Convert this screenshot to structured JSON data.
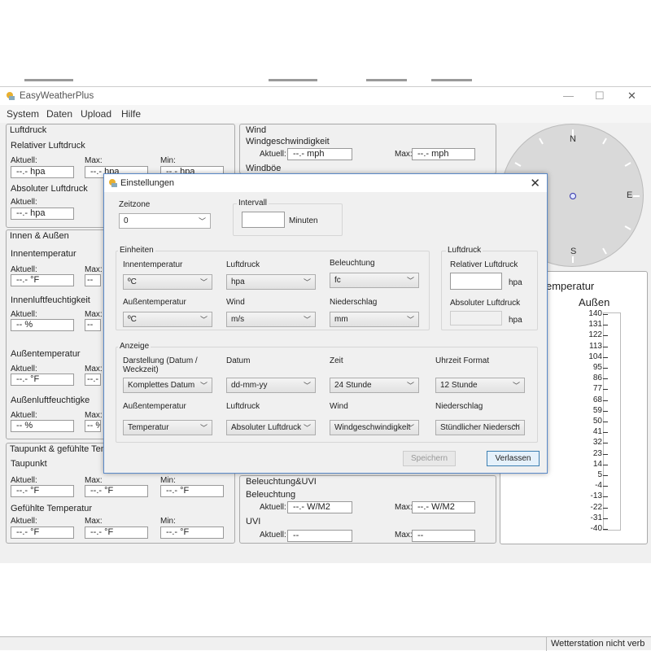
{
  "app": {
    "title": "EasyWeatherPlus",
    "minimize": "—",
    "maximize": "☐",
    "close": "✕"
  },
  "menu": [
    "System",
    "Daten",
    "Upload",
    "Hilfe"
  ],
  "luftdruck": {
    "title": "Luftdruck",
    "relativ": "Relativer Luftdruck",
    "absolut": "Absoluter Luftdruck",
    "aktuell": "Aktuell:",
    "max": "Max:",
    "min": "Min:",
    "rel_akt": "--.- hpa",
    "rel_max": "--.- hpa",
    "rel_min": "--.- hpa",
    "abs_akt": "--.- hpa"
  },
  "wind": {
    "title": "Wind",
    "geschw": "Windgeschwindigkeit",
    "aktuell": "Aktuell:",
    "max": "Max:",
    "akt_val": "--.- mph",
    "max_val": "--.- mph",
    "boe": "Windböe"
  },
  "innen": {
    "title": "Innen & Außen",
    "innentemp": "Innentemperatur",
    "innenfeucht": "Innenluftfeuchtigkeit",
    "aussentemp": "Außentemperatur",
    "aussenfeucht": "Außenluftfeuchtigke",
    "aktuell": "Aktuell:",
    "max": "Max:",
    "t_val": "--.- °F",
    "h_val": "-- %",
    "cut_t": "--",
    "cut_h": "--",
    "cut_mt": "--.-",
    "cut_mh": "-- %"
  },
  "taupunkt": {
    "title": "Taupunkt & gefühlte Temperatur",
    "taupunkt": "Taupunkt",
    "gefuehlt": "Gefühlte Temperatur",
    "aktuell": "Aktuell:",
    "max": "Max:",
    "min": "Min:",
    "val": "--.- °F"
  },
  "beleuchtung": {
    "title": "Beleuchtung&UVI",
    "beleuchtung": "Beleuchtung",
    "uvi": "UVI",
    "aktuell": "Aktuell:",
    "max": "Max:",
    "bel_val": "--.- W/M2",
    "uvi_val": "--"
  },
  "compass": {
    "n": "N",
    "e": "E",
    "s": "S"
  },
  "temp_panel": {
    "title": "emperatur",
    "aussen": "Außen",
    "scale": [
      "140",
      "131",
      "122",
      "113",
      "104",
      "95",
      "86",
      "77",
      "68",
      "59",
      "50",
      "41",
      "32",
      "23",
      "14",
      "5",
      "-4",
      "-13",
      "-22",
      "-31",
      "-40"
    ]
  },
  "status": "Wetterstation nicht verb",
  "dialog": {
    "title": "Einstellungen",
    "close": "✕",
    "zeitzone": {
      "label": "Zeitzone",
      "value": "0"
    },
    "intervall": {
      "label": "Intervall",
      "unit": "Minuten"
    },
    "einheiten": {
      "title": "Einheiten",
      "innentemp": {
        "label": "Innentemperatur",
        "value": "ºC"
      },
      "luftdruck": {
        "label": "Luftdruck",
        "value": "hpa"
      },
      "beleuchtung": {
        "label": "Beleuchtung",
        "value": "fc"
      },
      "aussentemp": {
        "label": "Außentemperatur",
        "value": "ºC"
      },
      "wind": {
        "label": "Wind",
        "value": "m/s"
      },
      "niederschlag": {
        "label": "Niederschlag",
        "value": "mm"
      }
    },
    "luftdruck": {
      "title": "Luftdruck",
      "relativ": "Relativer Luftdruck",
      "absolut": "Absoluter Luftdruck",
      "unit": "hpa"
    },
    "anzeige": {
      "title": "Anzeige",
      "darstellung": {
        "label": "Darstellung (Datum / Weckzeit)",
        "value": "Komplettes Datum"
      },
      "datum": {
        "label": "Datum",
        "value": "dd-mm-yy"
      },
      "zeit": {
        "label": "Zeit",
        "value": "24 Stunde"
      },
      "uhrzeit": {
        "label": "Uhrzeit Format",
        "value": "12 Stunde"
      },
      "aussentemp": {
        "label": "Außentemperatur",
        "value": "Temperatur"
      },
      "luftdruck": {
        "label": "Luftdruck",
        "value": "Absoluter Luftdruck"
      },
      "wind": {
        "label": "Wind",
        "value": "Windgeschwindigkeit"
      },
      "niederschlag": {
        "label": "Niederschlag",
        "value": "Stündlicher Niedersch"
      }
    },
    "save": "Speichern",
    "leave": "Verlassen"
  }
}
